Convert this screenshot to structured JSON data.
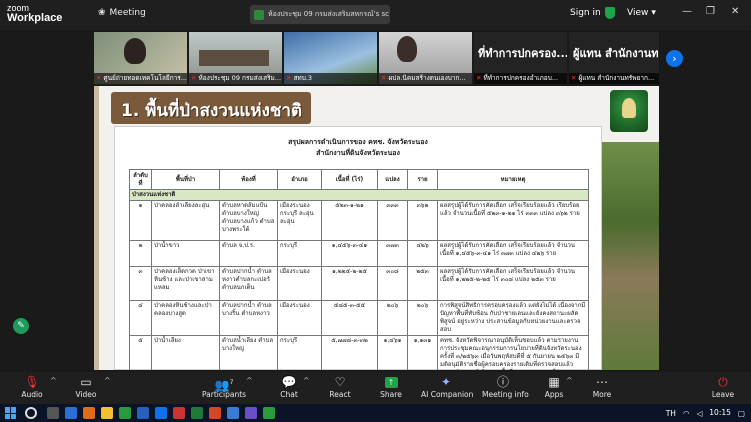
{
  "topbar": {
    "logo_top": "zoom",
    "logo_bottom": "Workplace",
    "meeting_label": "Meeting",
    "tab_title": "ห้องประชุม 09 กรมส่งเสริมสหกรณ์'s sc",
    "tab_more": "•••",
    "signin_label": "Sign in",
    "view_label": "View",
    "view_caret": "▾",
    "minimize": "—",
    "restore": "❐",
    "close": "✕"
  },
  "participants_strip": [
    {
      "name": "ศูนย์ถ่ายทอดเทคโนโลยีการ..."
    },
    {
      "name": "ห้องประชุม 09 กรมส่งเสริม..."
    },
    {
      "name": "สทบ.3"
    },
    {
      "name": "ผปล.นิคมสร้างตนเองบาก..."
    },
    {
      "name": "ที่ทำการปกครองอำเภอบ...",
      "big_text": "ที่ทำการปกครอง..."
    },
    {
      "name": "ผู้แทน สำนักงานทรัพยาก...",
      "big_text": "ผู้แทน สำนักงานท..."
    }
  ],
  "next_page": "›",
  "share": {
    "banner_title": "1. พื้นที่ป่าสงวนแห่งชาติ",
    "doc_title": "สรุปผลการดำเนินการของ คทช. จังหวัดระนอง",
    "doc_subtitle": "สำนักงานที่ดินจังหวัดระนอง",
    "columns": [
      "ลำดับที่",
      "พื้นที่ป่า",
      "ท้องที่",
      "อำเภอ",
      "เนื้อที่ (ไร่)",
      "แปลง",
      "ราย",
      "หมายเหตุ"
    ],
    "group_label": "ป่าสงวนแห่งชาติ",
    "rows": [
      {
        "no": "๑",
        "forest": "ป่าคลองลำเลียงละอุ่น",
        "area": "ตำบลหาดส้มแป้น ตำบลบางใหญ่ ตำบลบางแก้ว ตำบลบางพระใต้",
        "district": "เมืองระนอง กระบุรี ละอุ่น ละอุ่น",
        "rai": "๕๒๓-๑-๒๑",
        "plots": "๓๓๓",
        "people": "๓๖๒",
        "note": "ผลสรุปผู้ได้รับการคัดเลือก เสร็จเรียบร้อยแล้ว เรียบร้อยแล้ว จำนวนเนื้อที่ ๕๒๓-๑-๒๑ ไร่ ๓๓๓ แปลง ๓๖๒ ราย"
      },
      {
        "no": "๒",
        "forest": "ป่าน้ำขาว",
        "area": "ตำบล จ.ป.ร.",
        "district": "กระบุรี",
        "rai": "๑,๔๕๖-๓-๔๑",
        "plots": "๓๗๓",
        "people": "๔๒๖",
        "note": "ผลสรุปผู้ได้รับการคัดเลือก เสร็จเรียบร้อยแล้ว จำนวนเนื้อที่ ๑,๔๕๖-๓-๔๑ ไร่ ๓๗๓ แปลง ๔๒๖ ราย"
      },
      {
        "no": "๓",
        "forest": "ป่าคลองเส็ดกวด ป่าเขาหินช้าง และป่าเขาสามแหลม",
        "area": "ตำบลปากน้ำ ตำบลหงาวตำบลกะเปอร์ ตำบลนกเต็น",
        "district": "เมืองระนอง",
        "rai": "๑,๒๒๕-๒-๒๕",
        "plots": "๓๐๘",
        "people": "๒๕๓",
        "note": "ผลสรุปผู้ได้รับการคัดเลือก เสร็จเรียบร้อยแล้ว จำนวนเนื้อที่ ๑,๒๒๕-๒-๒๕ ไร่ ๓๐๘ แปลง ๒๕๓ ราย"
      },
      {
        "no": "๔",
        "forest": "ป่าคลองหินช้างและป่าคลองบางสูด",
        "area": "ตำบลปากน้ำ ตำบลบางริ้น ตำบลหงาว",
        "district": "เมืองระนอง",
        "rai": "๕๘๕-๓-๕๕",
        "plots": "๒๐๖",
        "people": "๒๐๖",
        "note": "การพิสูจน์สิทธิการครอบครองแล้ว แต่ยังไม่ได้ เนื่องจากมีปัญหาพื้นที่ทับซ้อน กับป่าชายเลนและยังคงสถานะผลัดพิสูจน์ อยู่ระหว่าง ประสานข้อมูลกับหน่วยงานและตรวจสอบ"
      },
      {
        "no": "๕",
        "forest": "ป่าน้ำเลียง",
        "area": "ตำบลน้ำเลียง ตำบล บางใหญ่",
        "district": "กระบุรี",
        "rai": "๕,๗๗๘-๓-๓๒",
        "plots": "๑,๔๖๑",
        "people": "๑,๑๓๑",
        "note": "คทช. จังหวัดพิจารณาอนุมัติเห็นชอบแล้ว ตามรายงานการประชุมคณะอนุกรรมการนโยบายที่ดินจังหวัดระนอง ครั้งที่ ๓/๒๕๖๓ เมื่อวันพฤหัสบดีที่ ๕ กันยายน ๒๕๖๓ มีมติอนุมัติรายชื่อผู้ครอบครองรายเดิมที่ตรวจสอบแล้ว ตามหลักเกณฑ์ จำนวนเนื้อที่ ๕,๗๗๘-๓-๓๒ ไร่ ๑,๔๖๑ แปลง ๑,๑๓๑ ราย"
      }
    ]
  },
  "toolbar": {
    "audio": "Audio",
    "video": "Video",
    "participants": "Participants",
    "participants_count": "7",
    "chat": "Chat",
    "react": "React",
    "share": "Share",
    "ai_companion": "AI Companion",
    "meeting_info": "Meeting info",
    "apps": "Apps",
    "more": "More",
    "leave": "Leave",
    "caret": "^"
  },
  "taskbar": {
    "lang": "TH",
    "time": "10:15"
  },
  "colors": {
    "zoom_blue": "#0e72ed",
    "leave_red": "#e33",
    "share_green": "#1ea54a"
  }
}
